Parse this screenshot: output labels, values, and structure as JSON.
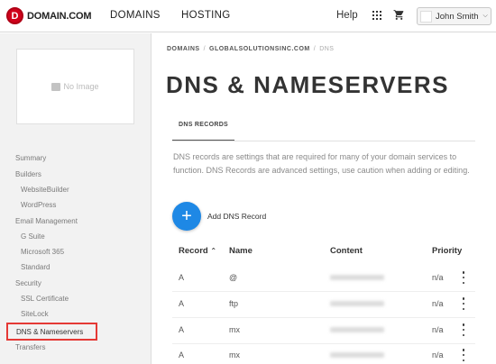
{
  "header": {
    "logo_letter": "D",
    "logo_text": "DOMAIN.COM",
    "nav": [
      "DOMAINS",
      "HOSTING"
    ],
    "help": "Help",
    "user_name": "John Smith",
    "apps_icon": "grid-icon",
    "cart_icon": "cart-icon",
    "accent_color": "#d0021b"
  },
  "sidebar": {
    "no_image": "No Image",
    "items": {
      "summary": "Summary",
      "builders": "Builders",
      "websitebuilder": "WebsiteBuilder",
      "wordpress": "WordPress",
      "email_management": "Email Management",
      "g_suite": "G Suite",
      "microsoft_365": "Microsoft 365",
      "standard": "Standard",
      "security": "Security",
      "ssl_certificate": "SSL Certificate",
      "sitelock": "SiteLock",
      "dns_nameservers": "DNS & Nameservers",
      "transfers": "Transfers"
    }
  },
  "main": {
    "breadcrumb": [
      "DOMAINS",
      "GLOBALSOLUTIONSINC.COM",
      "DNS"
    ],
    "title": "DNS & NAMESERVERS",
    "tab": "DNS RECORDS",
    "description": "DNS records are settings that are required for many of your domain services to function. DNS Records are advanced settings, use caution when adding or editing.",
    "add_label": "Add DNS Record",
    "add_button_color": "#1e88e5"
  },
  "table": {
    "headers": {
      "record": "Record",
      "name": "Name",
      "content": "Content",
      "priority": "Priority"
    },
    "sort_indicator": "^",
    "rows": [
      {
        "record": "A",
        "name": "@",
        "priority": "n/a"
      },
      {
        "record": "A",
        "name": "ftp",
        "priority": "n/a"
      },
      {
        "record": "A",
        "name": "mx",
        "priority": "n/a"
      },
      {
        "record": "A",
        "name": "mx",
        "priority": "n/a"
      }
    ]
  }
}
